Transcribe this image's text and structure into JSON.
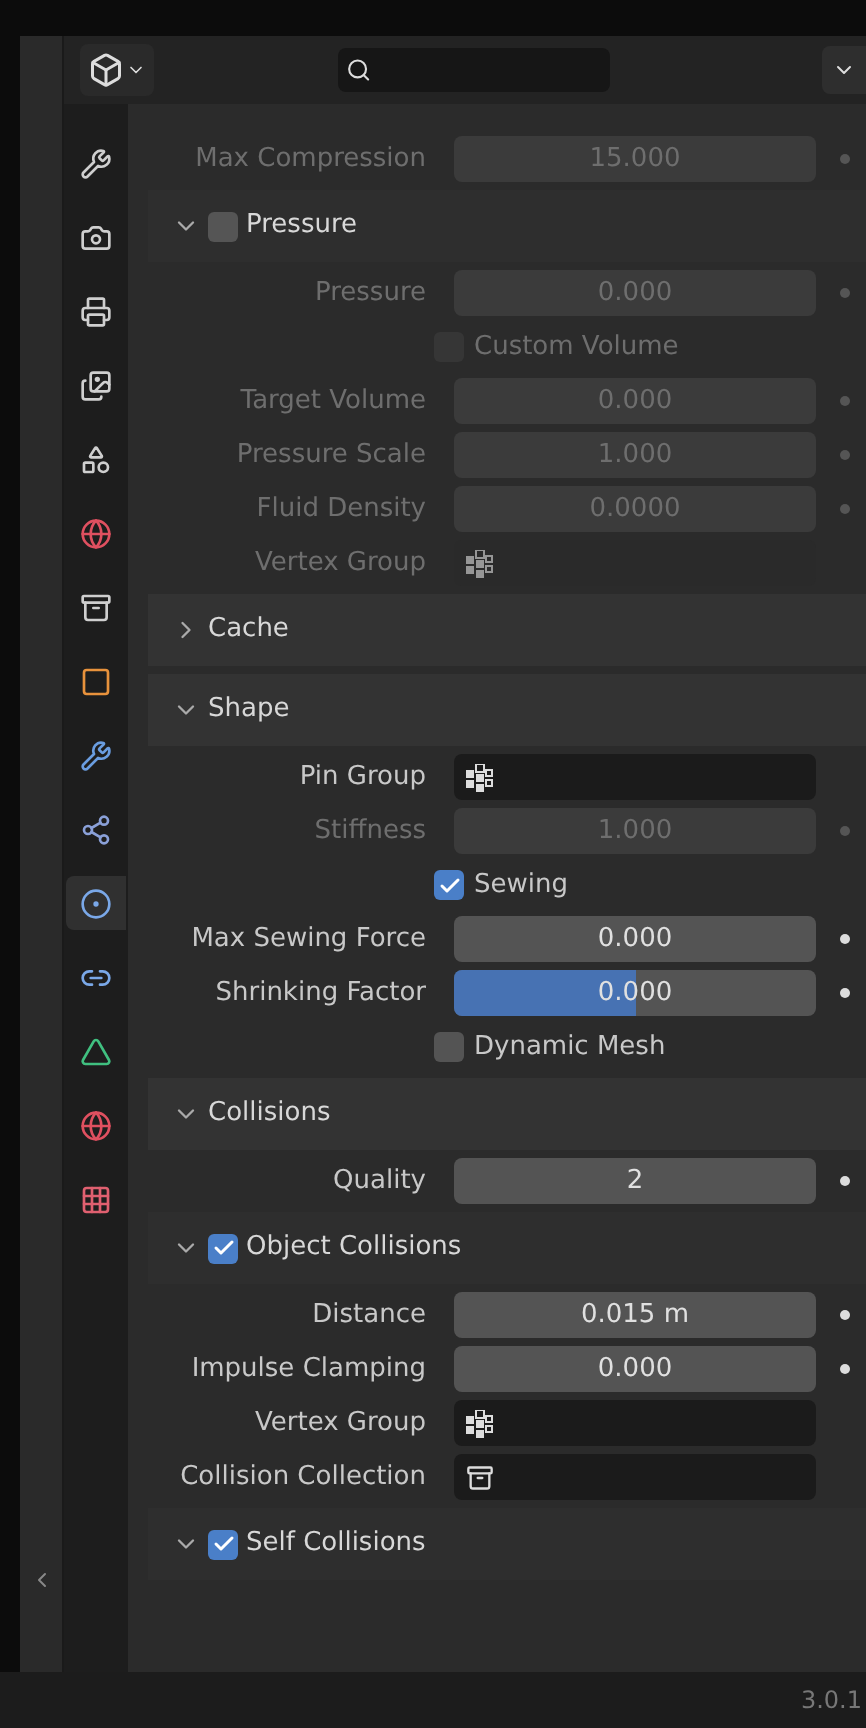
{
  "sidebar": [
    {
      "selected": false
    },
    {
      "selected": false
    },
    {
      "selected": false
    },
    {
      "selected": false
    },
    {
      "selected": false
    },
    {
      "selected": false
    },
    {
      "selected": false
    },
    {
      "selected": false
    },
    {
      "selected": false
    },
    {
      "selected": false
    },
    {
      "selected": true
    },
    {
      "selected": false
    },
    {
      "selected": false
    },
    {
      "selected": false
    },
    {
      "selected": false
    }
  ],
  "rows": [
    {
      "kind": "number",
      "label": "Max Compression",
      "value": "15.000",
      "disabled": true
    },
    {
      "kind": "check-panel",
      "label": "Pressure",
      "expanded": true,
      "checked": false
    },
    {
      "kind": "number",
      "label": "Pressure",
      "value": "0.000",
      "disabled": true
    },
    {
      "kind": "check",
      "label": "Custom Volume",
      "checked": false,
      "disabled": true
    },
    {
      "kind": "number",
      "label": "Target Volume",
      "value": "0.000",
      "disabled": true
    },
    {
      "kind": "number",
      "label": "Pressure Scale",
      "value": "1.000",
      "disabled": true
    },
    {
      "kind": "number",
      "label": "Fluid Density",
      "value": "0.0000",
      "disabled": true
    },
    {
      "kind": "picker",
      "label": "Vertex Group",
      "disabled": true
    },
    {
      "kind": "panel",
      "label": "Cache",
      "expanded": false
    },
    {
      "kind": "panel",
      "label": "Shape",
      "expanded": true
    },
    {
      "kind": "picker",
      "label": "Pin Group",
      "disabled": false
    },
    {
      "kind": "number",
      "label": "Stiffness",
      "value": "1.000",
      "disabled": true
    },
    {
      "kind": "check",
      "label": "Sewing",
      "checked": true,
      "disabled": false
    },
    {
      "kind": "number",
      "label": "Max Sewing Force",
      "value": "0.000",
      "disabled": false
    },
    {
      "kind": "number",
      "label": "Shrinking Factor",
      "value": "0.000",
      "disabled": false,
      "level": 0.5
    },
    {
      "kind": "check",
      "label": "Dynamic Mesh",
      "checked": false,
      "disabled": false
    },
    {
      "kind": "panel",
      "label": "Collisions",
      "expanded": true
    },
    {
      "kind": "number",
      "label": "Quality",
      "value": "2",
      "disabled": false
    },
    {
      "kind": "check-panel",
      "label": "Object Collisions",
      "expanded": true,
      "checked": true
    },
    {
      "kind": "number",
      "label": "Distance",
      "value": "0.015 m",
      "disabled": false
    },
    {
      "kind": "number",
      "label": "Impulse Clamping",
      "value": "0.000",
      "disabled": false
    },
    {
      "kind": "picker",
      "label": "Vertex Group",
      "disabled": false
    },
    {
      "kind": "collection-picker",
      "label": "Collision Collection",
      "disabled": false
    },
    {
      "kind": "check-panel",
      "label": "Self Collisions",
      "expanded": true,
      "checked": true
    }
  ],
  "status_bar": {
    "version": "3.0.1"
  }
}
